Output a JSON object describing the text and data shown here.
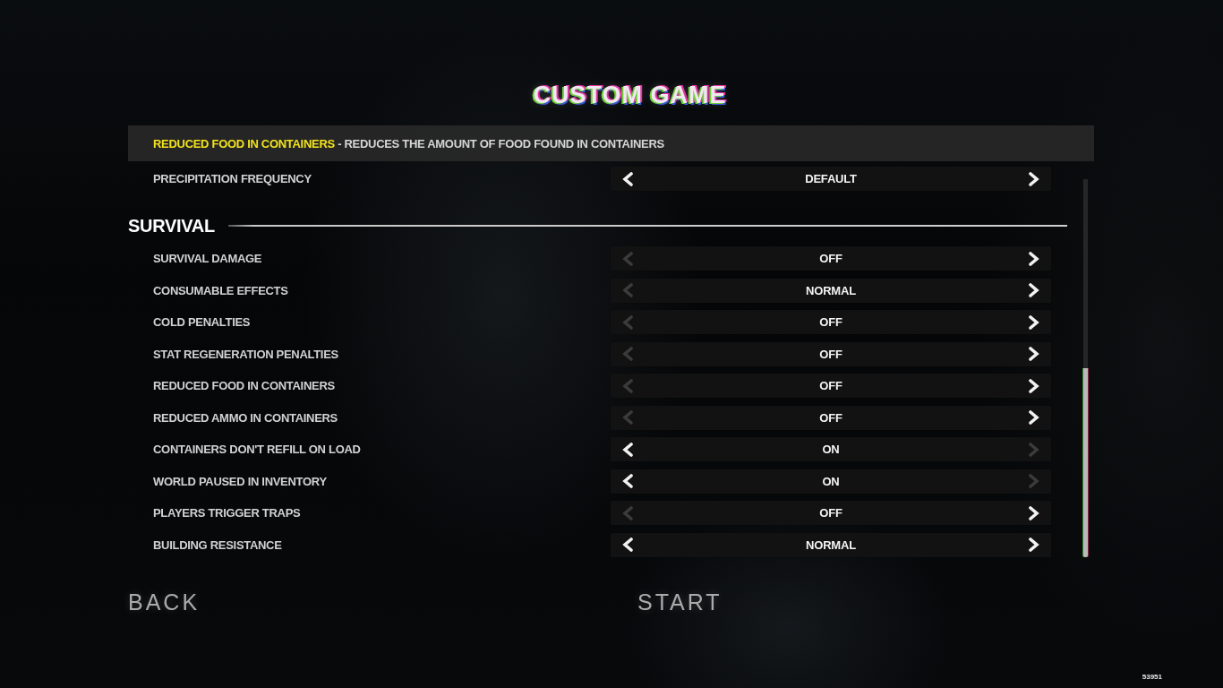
{
  "title": "CUSTOM GAME",
  "description_bar": {
    "setting": "REDUCED FOOD IN CONTAINERS",
    "text": "- REDUCES THE AMOUNT OF FOOD FOUND IN CONTAINERS"
  },
  "settings": [
    {
      "kind": "option",
      "label": "PRECIPITATION FREQUENCY",
      "value": "DEFAULT",
      "prev_disabled": false,
      "next_disabled": false
    },
    {
      "kind": "header",
      "label": "SURVIVAL"
    },
    {
      "kind": "option",
      "label": "SURVIVAL DAMAGE",
      "value": "OFF",
      "prev_disabled": true,
      "next_disabled": false
    },
    {
      "kind": "option",
      "label": "CONSUMABLE EFFECTS",
      "value": "NORMAL",
      "prev_disabled": true,
      "next_disabled": false
    },
    {
      "kind": "option",
      "label": "COLD PENALTIES",
      "value": "OFF",
      "prev_disabled": true,
      "next_disabled": false
    },
    {
      "kind": "option",
      "label": "STAT REGENERATION PENALTIES",
      "value": "OFF",
      "prev_disabled": true,
      "next_disabled": false
    },
    {
      "kind": "option",
      "label": "REDUCED FOOD IN CONTAINERS",
      "value": "OFF",
      "prev_disabled": true,
      "next_disabled": false
    },
    {
      "kind": "option",
      "label": "REDUCED AMMO IN CONTAINERS",
      "value": "OFF",
      "prev_disabled": true,
      "next_disabled": false
    },
    {
      "kind": "option",
      "label": "CONTAINERS DON'T REFILL ON LOAD",
      "value": "ON",
      "prev_disabled": false,
      "next_disabled": true
    },
    {
      "kind": "option",
      "label": "WORLD PAUSED IN INVENTORY",
      "value": "ON",
      "prev_disabled": false,
      "next_disabled": true
    },
    {
      "kind": "option",
      "label": "PLAYERS TRIGGER TRAPS",
      "value": "OFF",
      "prev_disabled": true,
      "next_disabled": false
    },
    {
      "kind": "option",
      "label": "BUILDING RESISTANCE",
      "value": "NORMAL",
      "prev_disabled": false,
      "next_disabled": false
    }
  ],
  "back_button": {
    "label": "BACK"
  },
  "start_button": {
    "label": "START"
  },
  "build_number": "53951"
}
